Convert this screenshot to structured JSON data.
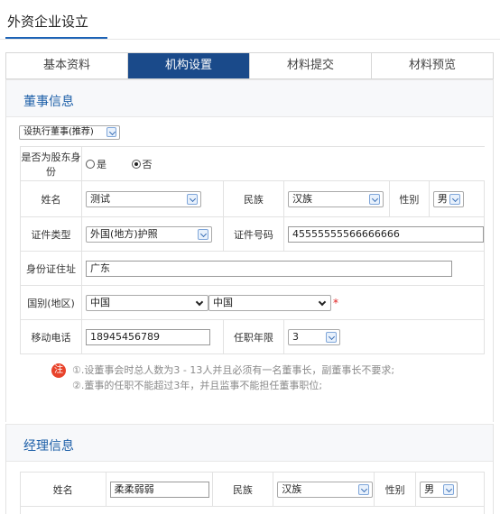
{
  "page": {
    "title": "外资企业设立"
  },
  "tabs": [
    {
      "label": "基本资料",
      "active": false
    },
    {
      "label": "机构设置",
      "active": true
    },
    {
      "label": "材料提交",
      "active": false
    },
    {
      "label": "材料预览",
      "active": false
    }
  ],
  "board": {
    "section_title": "董事信息",
    "type_select": "设执行董事(推荐)",
    "rows": {
      "shareholder_label": "是否为股东身份",
      "shareholder_yes": "是",
      "shareholder_no": "否",
      "shareholder_selected": "否",
      "name_label": "姓名",
      "name_value": "测试",
      "ethnicity_label": "民族",
      "ethnicity_value": "汉族",
      "gender_label": "性别",
      "gender_value": "男",
      "idtype_label": "证件类型",
      "idtype_value": "外国(地方)护照",
      "idnum_label": "证件号码",
      "idnum_value": "45555555566666666",
      "address_label": "身份证住址",
      "address_value": "广东",
      "country_label": "国别(地区)",
      "country_value_1": "中国",
      "country_value_2": "中国",
      "required_mark": "*",
      "phone_label": "移动电话",
      "phone_value": "18945456789",
      "term_label": "任职年限",
      "term_value": "3"
    },
    "note_badge": "注",
    "notes": [
      "①.设董事会时总人数为3 - 13人并且必须有一名董事长，副董事长不要求;",
      "②.董事的任职不能超过3年，并且监事不能担任董事职位;"
    ]
  },
  "manager": {
    "section_title": "经理信息",
    "name_label": "姓名",
    "name_value": "柔柔弱弱",
    "ethnicity_label": "民族",
    "ethnicity_value": "汉族",
    "gender_label": "性别",
    "gender_value": "男"
  },
  "colors": {
    "accent": "#1a4a8a",
    "title_blue": "#1d5fa8",
    "required": "#e02020",
    "badge": "#e8432b"
  },
  "icons": [
    "chevron-down-icon",
    "radio-icon",
    "note-icon"
  ]
}
